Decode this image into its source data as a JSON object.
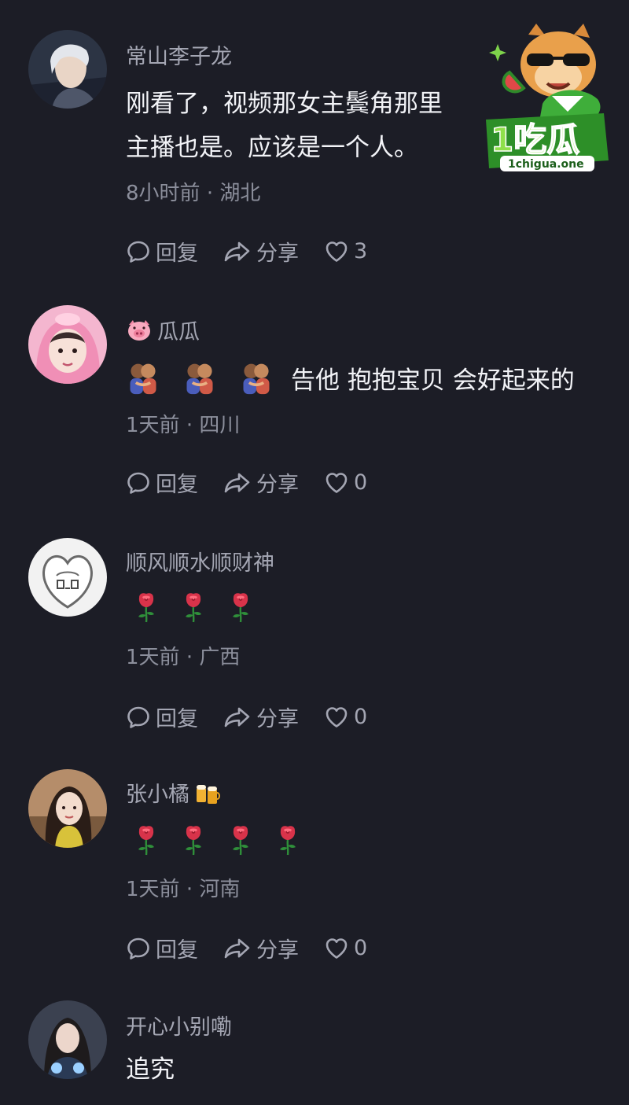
{
  "comments": [
    {
      "username": "常山李子龙",
      "text_lines": [
        "刚看了，视频那女主鬓角那里",
        "主播也是。应该是一个人。"
      ],
      "time": "8小时前",
      "location": "湖北",
      "reply_label": "回复",
      "share_label": "分享",
      "likes": "3"
    },
    {
      "username": "瓜瓜",
      "text": "告他 抱抱宝贝 会好起来的",
      "time": "1天前",
      "location": "四川",
      "reply_label": "回复",
      "share_label": "分享",
      "likes": "0"
    },
    {
      "username": "顺风顺水顺财神",
      "time": "1天前",
      "location": "广西",
      "reply_label": "回复",
      "share_label": "分享",
      "likes": "0"
    },
    {
      "username": "张小橘",
      "time": "1天前",
      "location": "河南",
      "reply_label": "回复",
      "share_label": "分享",
      "likes": "0"
    },
    {
      "username": "开心小别嘞",
      "text": "追究"
    }
  ],
  "meta_separator": "·",
  "watermark": {
    "brand": "1吃瓜",
    "url": "1chigua.one"
  },
  "icons": {
    "reply": "comment-bubble-icon",
    "share": "share-arrow-icon",
    "like": "heart-outline-icon",
    "pig": "pig-face-emoji",
    "hug": "hug-emoji",
    "rose": "rose-emoji",
    "beer": "beer-mugs-emoji"
  },
  "colors": {
    "background": "#1c1d26",
    "username": "#a4a6b3",
    "body_text": "#f2f3f7",
    "meta_text": "#8c8f9c",
    "brand_green": "#3a9a2b"
  }
}
